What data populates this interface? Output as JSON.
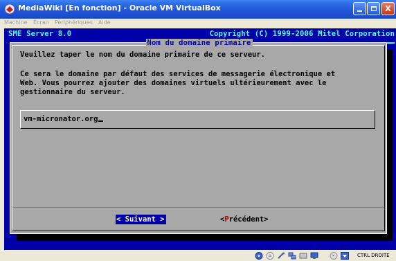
{
  "window": {
    "title": "MediaWiki [En fonction] - Oracle VM VirtualBox",
    "minimize_label": "",
    "maximize_label": "",
    "close_label": "X"
  },
  "menubar": {
    "items": [
      {
        "label": "Machine"
      },
      {
        "label": "Écran"
      },
      {
        "label": "Périphériques"
      },
      {
        "label": "Aide"
      }
    ]
  },
  "console": {
    "header_left": "SME Server 8.0",
    "header_right": "Copyright (C) 1999-2006 Mitel Corporation"
  },
  "dialog": {
    "title": "Nom du domaine primaire",
    "prompt": "Veuillez taper le nom du domaine primaire de ce serveur.",
    "description_lines": [
      "Ce sera le domaine par défaut des services de messagerie électronique et",
      "Web. Vous pourrez ajouter des domaines virtuels ultérieurement avec le",
      "gestionnaire du serveur."
    ],
    "input_value": "vm-micronator.org",
    "next_button": {
      "open": "< ",
      "hotkey": "S",
      "rest": "uivant",
      "close": " >"
    },
    "prev_button": {
      "open": "<",
      "hotkey": "P",
      "rest": "récédent",
      "close": ">"
    }
  },
  "statusbar": {
    "host_key_label": "CTRL DROITE",
    "icons": [
      "hard-disk-icon",
      "cd-icon",
      "usb-icon",
      "network-icon",
      "shared-folders-icon",
      "display-icon",
      "mouse-integration-icon",
      "host-key-arrow-icon"
    ]
  },
  "colors": {
    "titlebar": "#2E6CE6",
    "console_bg": "#0000A8",
    "console_header": "#55FFFF",
    "dialog_bg": "#A8A8A8",
    "hotkey": "#FFFF55",
    "prev_hotkey": "#AA0000"
  }
}
